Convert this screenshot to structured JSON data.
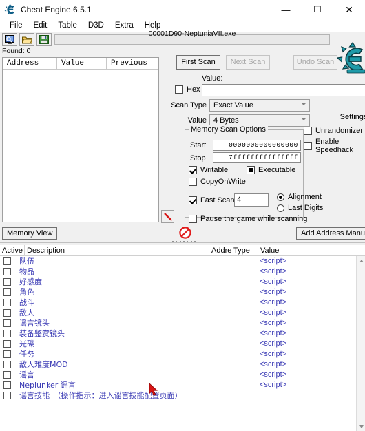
{
  "window": {
    "title": "Cheat Engine 6.5.1",
    "app_icon": "cheat-engine-logo-icon",
    "minimize_label": "—",
    "maximize_label": "☐",
    "close_label": "✕"
  },
  "menu": {
    "items": [
      {
        "label": "File"
      },
      {
        "label": "Edit"
      },
      {
        "label": "Table"
      },
      {
        "label": "D3D"
      },
      {
        "label": "Extra"
      },
      {
        "label": "Help"
      }
    ]
  },
  "toolbar": {
    "buttons": [
      {
        "name": "open-process-button",
        "icon": "computer-magnifier-icon"
      },
      {
        "name": "open-file-button",
        "icon": "folder-open-icon"
      },
      {
        "name": "save-file-button",
        "icon": "floppy-disk-icon"
      }
    ],
    "process_label": "00001D90-NeptuniaVII.exe",
    "process_input_value": ""
  },
  "status": {
    "found_label": "Found: 0"
  },
  "results": {
    "columns": [
      "Address",
      "Value",
      "Previous"
    ],
    "rows": []
  },
  "scan": {
    "first_scan_label": "First Scan",
    "next_scan_label": "Next Scan",
    "undo_scan_label": "Undo Scan",
    "settings_label": "Settings",
    "value_label": "Value:",
    "value_input": "",
    "hex_label": "Hex",
    "hex_checked": false,
    "scan_type_label": "Scan Type",
    "scan_type_value": "Exact Value",
    "value_type_label": "Value Type",
    "value_type_value": "4 Bytes",
    "memory_scan_options": {
      "title": "Memory Scan Options",
      "start_label": "Start",
      "start_value": "0000000000000000",
      "stop_label": "Stop",
      "stop_value": "7fffffffffffffff",
      "writable_label": "Writable",
      "writable_checked": true,
      "executable_label": "Executable",
      "executable_state": "grayed",
      "copyonwrite_label": "CopyOnWrite",
      "copyonwrite_checked": false,
      "fast_scan_label": "Fast Scan",
      "fast_scan_checked": true,
      "fast_scan_value": "4",
      "alignment_label": "Alignment",
      "alignment_selected": true,
      "last_digits_label": "Last Digits",
      "last_digits_selected": false,
      "pause_label": "Pause the game while scanning",
      "pause_checked": false
    },
    "unrandomizer_label": "Unrandomizer",
    "unrandomizer_checked": false,
    "speedhack_label": "Enable Speedhack",
    "speedhack_checked": false,
    "pointer_icon": "red-crosshair-pointer-icon"
  },
  "midbar": {
    "memory_view_label": "Memory View",
    "add_address_label": "Add Address Manually",
    "no_entry_icon": "no-entry-icon"
  },
  "cheat_table": {
    "columns": [
      "Active",
      "Description",
      "Addre",
      "Type",
      "Value"
    ],
    "script_value": "<script>",
    "rows": [
      {
        "active": false,
        "description": "队伍",
        "value": "<script>"
      },
      {
        "active": false,
        "description": "物品",
        "value": "<script>"
      },
      {
        "active": false,
        "description": "好感度",
        "value": "<script>"
      },
      {
        "active": false,
        "description": "角色",
        "value": "<script>"
      },
      {
        "active": false,
        "description": "战斗",
        "value": "<script>"
      },
      {
        "active": false,
        "description": "敌人",
        "value": "<script>"
      },
      {
        "active": false,
        "description": "谣言镜头",
        "value": "<script>"
      },
      {
        "active": false,
        "description": "装备鉴赏镜头",
        "value": "<script>"
      },
      {
        "active": false,
        "description": "光碟",
        "value": "<script>"
      },
      {
        "active": false,
        "description": "任务",
        "value": "<script>"
      },
      {
        "active": false,
        "description": "敌人难度MOD",
        "value": "<script>"
      },
      {
        "active": false,
        "description": "谣言",
        "value": "<script>"
      },
      {
        "active": false,
        "description": "Neplunker 谣言",
        "value": "<script>"
      },
      {
        "active": false,
        "description": "谣言技能　（操作指示：进入谣言技能配置页面）",
        "value": ""
      }
    ]
  },
  "colors": {
    "window_bg": "#f0f0f0",
    "panel_bg": "#ffffff",
    "script_text": "#3b3bb5",
    "logo_teal": "#1f9aa8",
    "no_entry_red": "#e01b1b",
    "cursor_red": "#d81616"
  }
}
